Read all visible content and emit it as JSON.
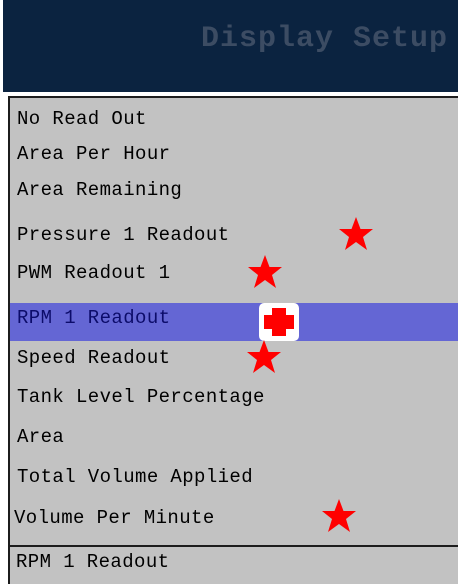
{
  "header": {
    "title": "Display Setup",
    "background": "#0b2340",
    "title_color": "#3c4c63"
  },
  "list": {
    "items": [
      {
        "label": "No Read Out",
        "marker": "none"
      },
      {
        "label": "Area Per Hour",
        "marker": "none"
      },
      {
        "label": "Area Remaining",
        "marker": "none"
      },
      {
        "label": "Pressure 1 Readout",
        "marker": "star-icon"
      },
      {
        "label": "PWM Readout 1",
        "marker": "star-icon"
      },
      {
        "label": "RPM 1 Readout",
        "marker": "cross-icon",
        "selected": true
      },
      {
        "label": "Speed Readout",
        "marker": "star-icon"
      },
      {
        "label": "Tank Level Percentage",
        "marker": "none"
      },
      {
        "label": "Area",
        "marker": "none"
      },
      {
        "label": "Total Volume Applied",
        "marker": "none"
      },
      {
        "label": "Volume Per Minute",
        "marker": "star-icon"
      }
    ],
    "background": "#c2c2c2",
    "selected_background": "#6466d4",
    "marker_color": "#ff0000"
  },
  "footer": {
    "current_value": "RPM 1 Readout"
  }
}
